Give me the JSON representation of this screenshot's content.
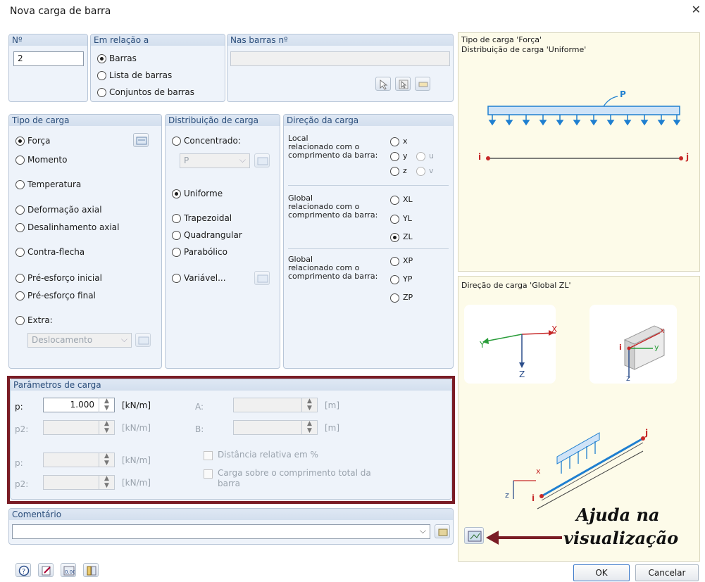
{
  "dialog": {
    "title": "Nova carga de barra"
  },
  "number": {
    "label": "Nº",
    "value": "2"
  },
  "relation": {
    "label": "Em relação a",
    "options": [
      "Barras",
      "Lista de barras",
      "Conjuntos de barras"
    ],
    "selected": "Barras"
  },
  "members": {
    "label": "Nas barras nº",
    "value": ""
  },
  "load_type": {
    "label": "Tipo de carga",
    "options": [
      "Força",
      "Momento",
      "Temperatura",
      "Deformação axial",
      "Desalinhamento axial",
      "Contra-flecha",
      "Pré-esforço inicial",
      "Pré-esforço final",
      "Extra:"
    ],
    "selected": "Força",
    "extra_value": "Deslocamento"
  },
  "distribution": {
    "label": "Distribuição de carga",
    "options": [
      "Concentrado:",
      "Uniforme",
      "Trapezoidal",
      "Quadrangular",
      "Parabólico",
      "Variável..."
    ],
    "selected": "Uniforme",
    "concentrated_value": "P"
  },
  "direction": {
    "label": "Direção da carga",
    "groups": [
      {
        "title": "Local",
        "desc1": "relacionado com o",
        "desc2": "comprimento da barra:",
        "options": [
          "x",
          "y",
          "z"
        ],
        "extra": [
          "u",
          "v"
        ]
      },
      {
        "title": "Global",
        "desc1": "relacionado com o",
        "desc2": "comprimento da barra:",
        "options": [
          "XL",
          "YL",
          "ZL"
        ]
      },
      {
        "title": "Global",
        "desc1": "relacionado com o",
        "desc2": "comprimento da barra:",
        "options": [
          "XP",
          "YP",
          "ZP"
        ]
      }
    ],
    "selected": "ZL"
  },
  "params": {
    "label": "Parâmetros de carga",
    "p_label": "p:",
    "p_value": "1.000",
    "p_unit": "[kN/m]",
    "p2_label": "p2:",
    "p2_unit": "[kN/m]",
    "p3_label": "p:",
    "p3_unit": "[kN/m]",
    "p4_label": "p2:",
    "p4_unit": "[kN/m]",
    "a_label": "A:",
    "a_unit": "[m]",
    "b_label": "B:",
    "b_unit": "[m]",
    "rel_dist": "Distância relativa em %",
    "full_len1": "Carga sobre o comprimento total da",
    "full_len2": "barra"
  },
  "comment": {
    "label": "Comentário",
    "value": ""
  },
  "preview": {
    "line1": "Tipo de carga 'Força'",
    "line2": "Distribuição de carga 'Uniforme'",
    "p_symbol": "P",
    "i_label": "i",
    "j_label": "j",
    "dir_title": "Direção de carga 'Global ZL'",
    "axis_x": "X",
    "axis_y": "Y",
    "axis_z": "Z",
    "axis_x_small": "x",
    "axis_y_small": "y",
    "axis_z_small": "z"
  },
  "annotation": {
    "line1": "Ajuda na",
    "line2": "visualização"
  },
  "buttons": {
    "ok": "OK",
    "cancel": "Cancelar"
  },
  "colors": {
    "accent_red": "#7a1c25",
    "load_blue": "#1f7fd0",
    "member_red": "#c62828"
  }
}
